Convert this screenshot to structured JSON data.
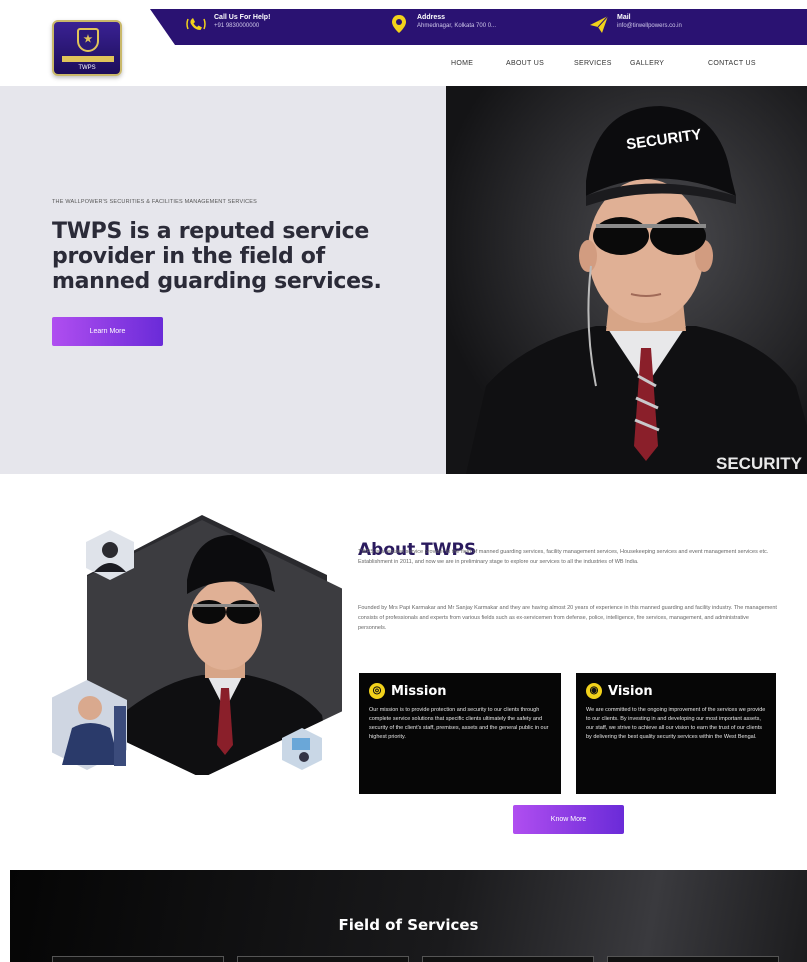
{
  "topbar": {
    "call": {
      "label": "Call Us For Help!",
      "value": "+91 9830000000",
      "icon": "phone-ringing-icon"
    },
    "address": {
      "label": "Address",
      "value": "Ahmednagar, Kolkata 700 0...",
      "icon": "location-pin-icon"
    },
    "mail": {
      "label": "Mail",
      "value": "info@tirwellpowers.co.in",
      "icon": "paper-plane-icon"
    }
  },
  "logo": {
    "text": "TWPS"
  },
  "nav": {
    "items": [
      "HOME",
      "ABOUT US",
      "SERVICES",
      "GALLERY",
      "CONTACT US"
    ]
  },
  "hero": {
    "kicker": "THE WALLPOWER'S SECURITIES & FACILITIES MANAGEMENT SERVICES",
    "title": "TWPS is a reputed service provider in the field of manned guarding services.",
    "button": "Learn More",
    "cap_text": "SECURITY",
    "jacket_text": "SECURITY"
  },
  "about": {
    "title": "About TWPS",
    "para1": "TWPS is a reputed service provider in the field of manned guarding services, facility management services, Housekeeping services and event management services etc. Establishment in 2011, and now we are in preliminary stage to explore our services to all the industries of WB India.",
    "para2": "Founded by Mrs Papi Karmakar and Mr Sanjay Karmakar and they are having almost 20 years of experience in this manned guarding and facility industry. The management consists of professionals and experts from various fields such as ex-servicemen from defense, police, intelligence, fire services, management, and administrative personnels.",
    "mission": {
      "title": "Mission",
      "body": "Our mission is to provide protection and security to our clients through complete service solutions that specific clients ultimately the safety and security of the client's staff, premises, assets and the general public in our highest priority."
    },
    "vision": {
      "title": "Vision",
      "body": "We are committed to the ongoing improvement of the services we provide to our clients. By investing in and developing our most important assets, our staff, we strive to achieve all our vision to earn the trust of our clients by delivering the best quality security services within the West Bengal."
    },
    "button": "Know More"
  },
  "services": {
    "title": "Field of Services"
  },
  "colors": {
    "brand": "#2a1272",
    "accent": "#f2d21b",
    "button_start": "#b04ef0",
    "button_end": "#6a2bd8"
  }
}
